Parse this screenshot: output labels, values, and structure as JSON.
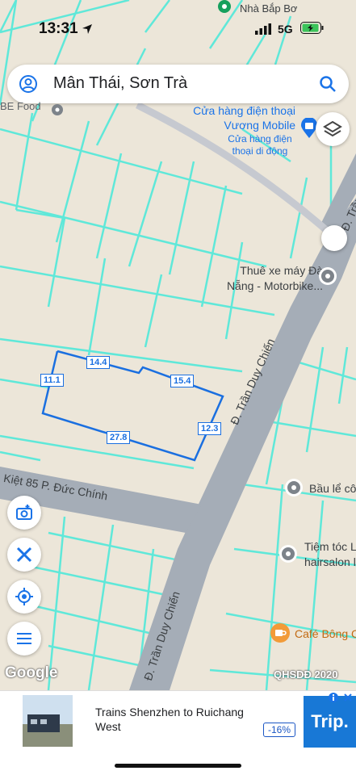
{
  "status_bar": {
    "time": "13:31",
    "network": "5G"
  },
  "search": {
    "query": "Mân Thái, Sơn Trà"
  },
  "pois": {
    "top_place": "Nhà Bắp Bơ",
    "food_partial": "BE Food",
    "phone_store_title": [
      "Cửa hàng điện thoại",
      "Vương Mobile"
    ],
    "phone_store_sub": [
      "Cửa hàng điện",
      "thoại di động"
    ],
    "motorbike": [
      "Thuê xe máy Đà",
      "Nẵng - Motorbike..."
    ],
    "bau": "Bầu lể cô",
    "hair": [
      "Tiệm tóc L",
      "hairsalon l"
    ],
    "cafe": "Café Bông C"
  },
  "streets": {
    "main_upper": "Đ. Trần Duy Chiến",
    "main_lower": "Đ. Trần Duy Chiến",
    "top_right": "Đ. Trần",
    "alley": "Kiệt 85 P. Đức Chính"
  },
  "measurements": {
    "top_left": "14.4",
    "top_right": "15.4",
    "left": "11.1",
    "right": "12.3",
    "bottom": "27.8"
  },
  "attribution": {
    "logo": "Google",
    "layer": "QHSDĐ 2020"
  },
  "ad": {
    "title": "Trains Shenzhen to Ruichang West",
    "discount": "-16%",
    "brand": "Trip."
  },
  "colors": {
    "map_bg": "#ece6d9",
    "parcel_line": "#5fe8d9",
    "road": "#a5adb7",
    "measure_blue": "#1a6fe0"
  }
}
